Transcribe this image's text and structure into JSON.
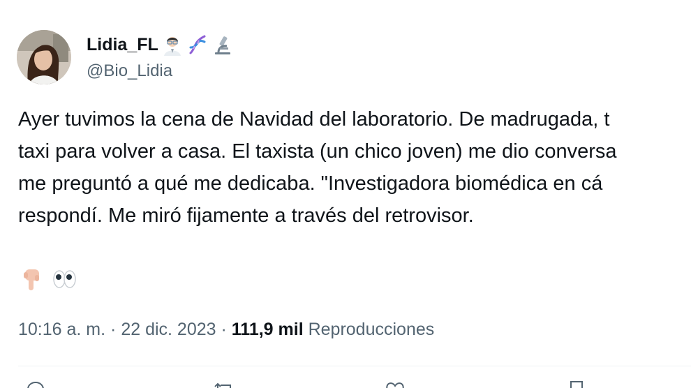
{
  "author": {
    "display_name": "Lidia_FL",
    "name_emojis": [
      "woman-scientist-icon",
      "dna-icon",
      "microscope-icon"
    ],
    "handle": "@Bio_Lidia"
  },
  "tweet": {
    "lines": [
      "Ayer tuvimos la cena de Navidad del laboratorio. De madrugada, t",
      "taxi para volver a casa. El taxista (un chico joven) me dio conversa",
      "me preguntó a qué me dedicaba. \"Investigadora biomédica en cá",
      "respondí. Me miró fijamente a través del retrovisor."
    ],
    "emojis": [
      "backhand-index-pointing-down-icon",
      "eyes-icon"
    ]
  },
  "meta": {
    "time": "10:16 a. m.",
    "separator": "·",
    "date": "22 dic. 2023",
    "views_count": "111,9 mil",
    "views_label": "Reproducciones"
  },
  "actions": [
    "reply-icon",
    "retweet-icon",
    "like-icon",
    "bookmark-icon"
  ],
  "colors": {
    "primary_text": "#0f1419",
    "secondary_text": "#536471",
    "divider": "#eff3f4"
  }
}
